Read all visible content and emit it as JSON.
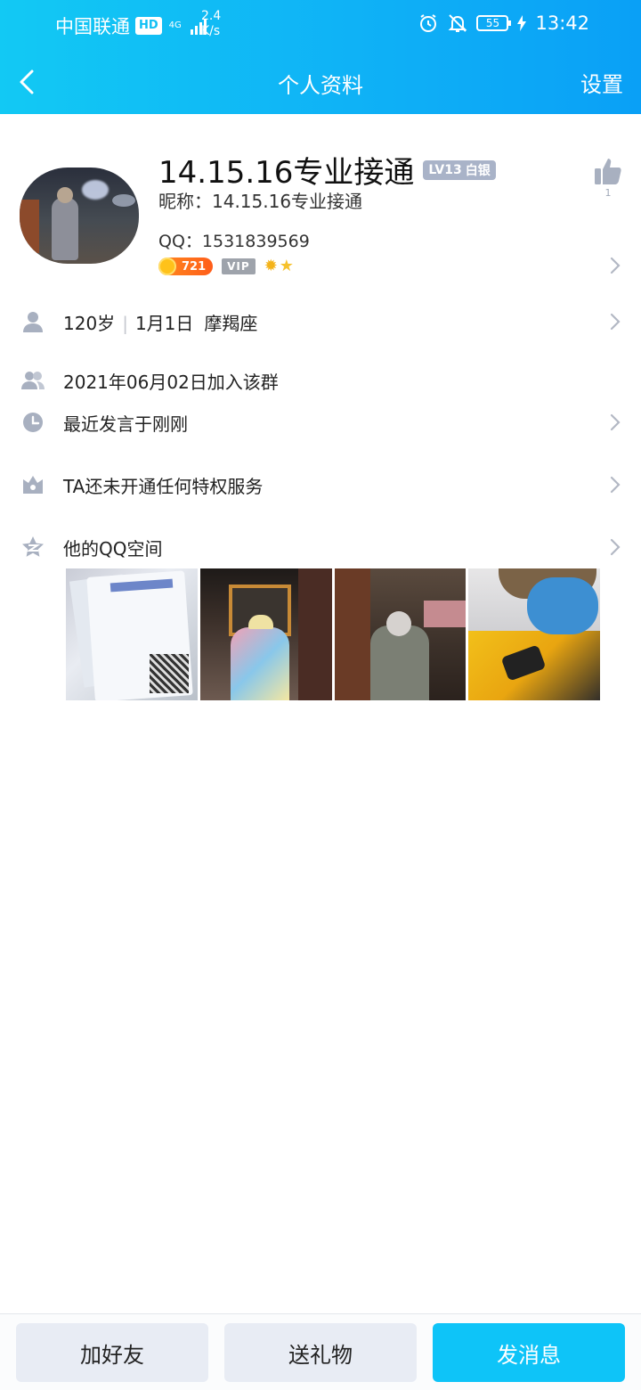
{
  "status_bar": {
    "carrier": "中国联通",
    "hd": "HD",
    "network": "4G",
    "net_speed_value": "2.4",
    "net_speed_unit": "K/s",
    "battery": "55",
    "time": "13:42"
  },
  "nav": {
    "title": "个人资料",
    "settings_label": "设置"
  },
  "profile": {
    "name": "14.15.16专业接通",
    "level_badge": "LV13",
    "level_title": "白银",
    "nickname": "昵称：14.15.16专业接通",
    "qq": "QQ：1531839569",
    "coins": "721",
    "vip": "VIP",
    "like_count": "1"
  },
  "rows": {
    "basic_age": "120岁",
    "basic_birthday": "1月1日",
    "basic_zodiac": "摩羯座",
    "join_date": "2021年06月02日加入该群",
    "last_speak": "最近发言于刚刚",
    "privilege": "TA还未开通任何特权服务",
    "qzone": "他的QQ空间"
  },
  "bottom": {
    "add_friend": "加好友",
    "send_gift": "送礼物",
    "send_message": "发消息"
  },
  "colors": {
    "header_start": "#12c9f4",
    "header_end": "#0aa0f6",
    "primary_button": "#0ec4f8",
    "secondary_button": "#e8ecf4",
    "icon_gray": "#a8b0c0"
  }
}
